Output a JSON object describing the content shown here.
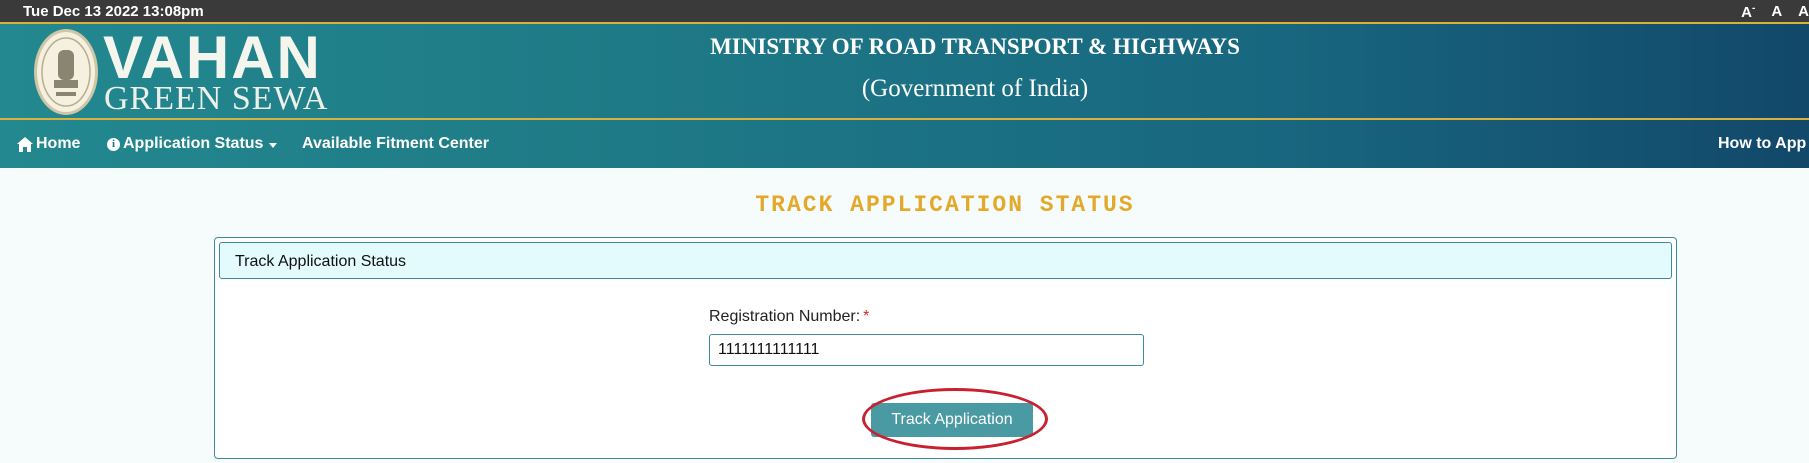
{
  "topbar": {
    "datetime": "Tue Dec 13 2022 13:08pm",
    "font_small": "A",
    "font_small_sup": "-",
    "font_normal": "A",
    "font_large": "A"
  },
  "header": {
    "logo_main": "VAHAN",
    "logo_sub": "GREEN SEWA",
    "ministry": "MINISTRY OF ROAD TRANSPORT & HIGHWAYS",
    "government": "(Government of India)"
  },
  "nav": {
    "home": "Home",
    "application_status": "Application Status",
    "available_fitment_center": "Available Fitment Center",
    "how_to_apply": "How to App"
  },
  "page": {
    "title": "TRACK APPLICATION STATUS",
    "panel_heading": "Track Application Status",
    "registration_label": "Registration Number:",
    "required_mark": "*",
    "registration_value": "1111111111111",
    "track_button": "Track Application"
  },
  "colors": {
    "accent_gold": "#e2a92b",
    "header_teal": "#1e7a86",
    "button_teal": "#4a9aa3",
    "highlight_red": "#c8202e"
  }
}
